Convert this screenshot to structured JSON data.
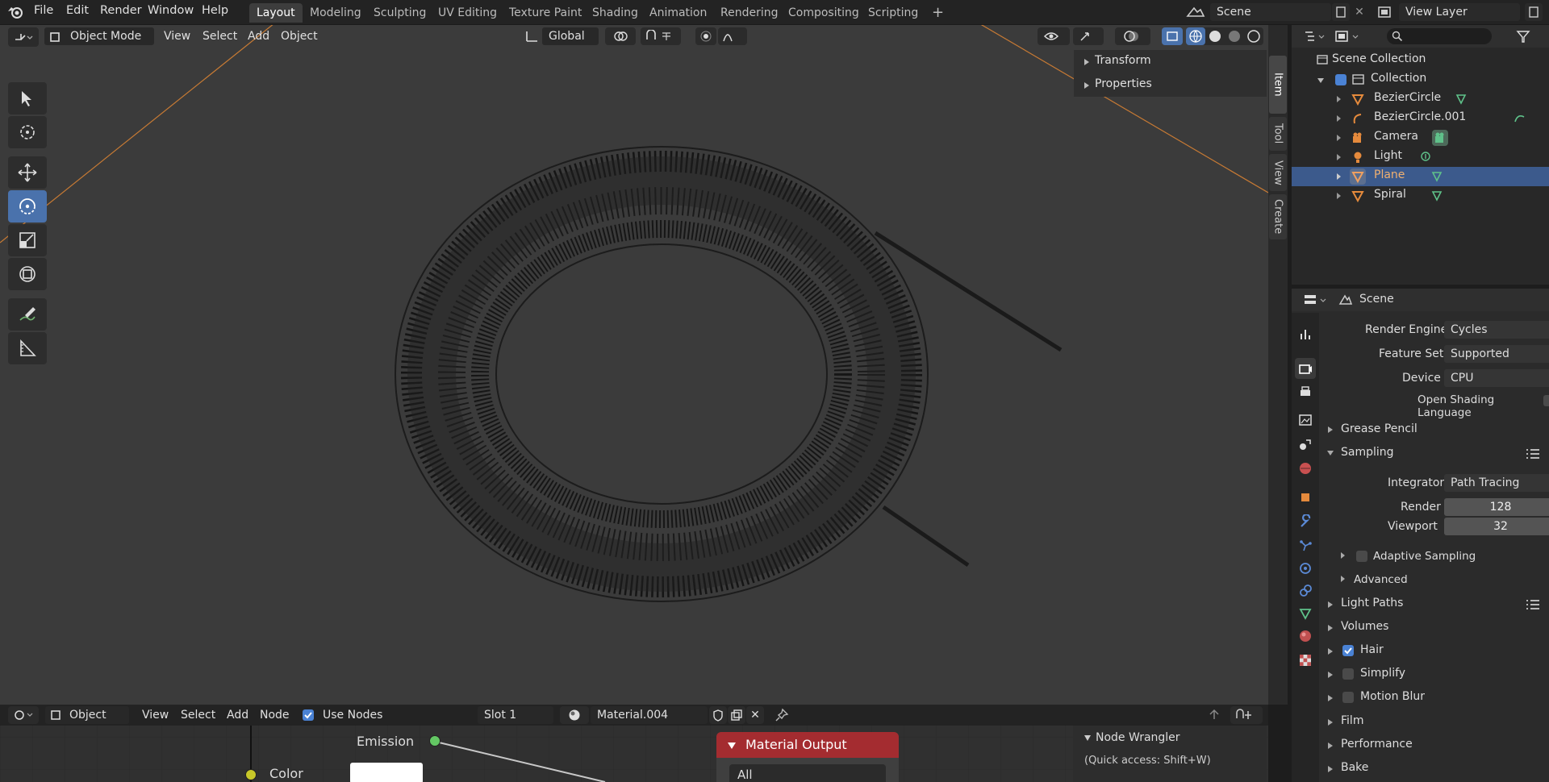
{
  "topbar": {
    "menus": [
      "File",
      "Edit",
      "Render",
      "Window",
      "Help"
    ],
    "workspaces": [
      "Layout",
      "Modeling",
      "Sculpting",
      "UV Editing",
      "Texture Paint",
      "Shading",
      "Animation",
      "Rendering",
      "Compositing",
      "Scripting"
    ],
    "active_workspace": "Layout",
    "add_tab": "+",
    "scene": "Scene",
    "view_layer": "View Layer"
  },
  "viewport_header": {
    "mode": "Object Mode",
    "menus": [
      "View",
      "Select",
      "Add",
      "Object"
    ],
    "orientation": "Global"
  },
  "npanel": {
    "sections": [
      "Transform",
      "Properties"
    ],
    "tabs": [
      "Item",
      "Tool",
      "View",
      "Create"
    ]
  },
  "outliner": {
    "root": "Scene Collection",
    "collection": "Collection",
    "items": [
      {
        "name": "BezierCircle",
        "selected": false
      },
      {
        "name": "BezierCircle.001",
        "selected": false
      },
      {
        "name": "Camera",
        "selected": false
      },
      {
        "name": "Light",
        "selected": false
      },
      {
        "name": "Plane",
        "selected": true
      },
      {
        "name": "Spiral",
        "selected": false
      }
    ]
  },
  "properties": {
    "context": "Scene",
    "render_engine": {
      "label": "Render Engine",
      "value": "Cycles"
    },
    "feature_set": {
      "label": "Feature Set",
      "value": "Supported"
    },
    "device": {
      "label": "Device",
      "value": "CPU"
    },
    "osl": "Open Shading Language",
    "grease_pencil": "Grease Pencil",
    "sampling": "Sampling",
    "integrator": {
      "label": "Integrator",
      "value": "Path Tracing"
    },
    "render": {
      "label": "Render",
      "value": "128"
    },
    "viewport": {
      "label": "Viewport",
      "value": "32"
    },
    "adaptive": "Adaptive Sampling",
    "advanced": "Advanced",
    "light_paths": "Light Paths",
    "volumes": "Volumes",
    "hair": "Hair",
    "simplify": "Simplify",
    "motion_blur": "Motion Blur",
    "film": "Film",
    "performance": "Performance",
    "bake": "Bake"
  },
  "node_editor": {
    "object": "Object",
    "menus": [
      "View",
      "Select",
      "Add",
      "Node"
    ],
    "use_nodes": "Use Nodes",
    "slot": "Slot 1",
    "material": "Material.004",
    "emission": "Emission",
    "color": "Color",
    "material_output": "Material Output",
    "target": "All",
    "node_wrangler": "Node Wrangler",
    "nw_hint": "(Quick access: Shift+W)"
  },
  "colors": {
    "accent": "#4a72ac",
    "selected_row": "#3c5a8c",
    "node_header": "#a42c30",
    "socket_green": "#63c763",
    "socket_yellow": "#c7c729"
  }
}
